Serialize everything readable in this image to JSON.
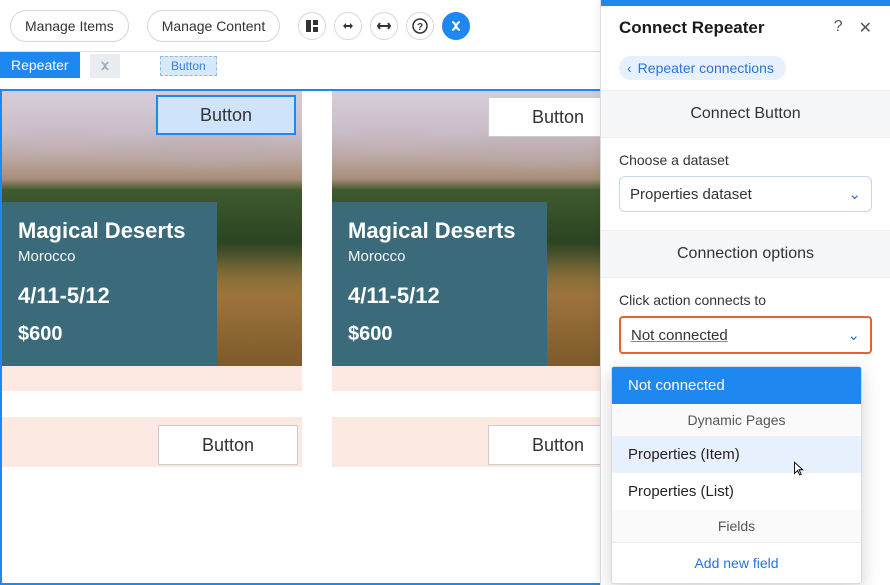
{
  "toolbar": {
    "manage_items": "Manage Items",
    "manage_content": "Manage Content"
  },
  "repeater_tag": "Repeater",
  "button_tag": "Button",
  "cards": [
    {
      "title": "Magical Deserts",
      "sub": "Morocco",
      "dates": "4/11-5/12",
      "price": "$600",
      "btn": "Button"
    },
    {
      "title": "Magical Deserts",
      "sub": "Morocco",
      "dates": "4/11-5/12",
      "price": "$600",
      "btn": "Button"
    }
  ],
  "bottom_btn": "Button",
  "panel": {
    "title": "Connect Repeater",
    "back": "Repeater connections",
    "section1": "Connect Button",
    "dataset_label": "Choose a dataset",
    "dataset_value": "Properties dataset",
    "section2": "Connection options",
    "action_label": "Click action connects to",
    "action_value": "Not connected"
  },
  "dropdown": {
    "selected": "Not connected",
    "group1": "Dynamic Pages",
    "opt1": "Properties (Item)",
    "opt2": "Properties (List)",
    "group2": "Fields",
    "add": "Add new field"
  }
}
